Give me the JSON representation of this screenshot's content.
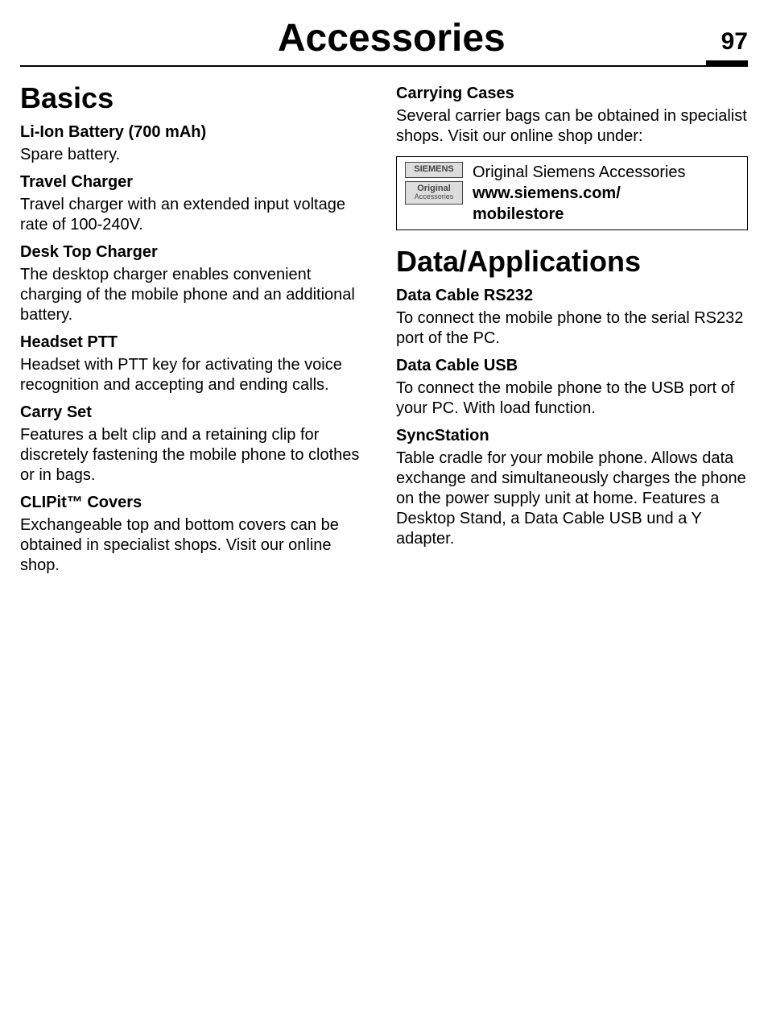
{
  "header": {
    "title": "Accessories",
    "page_number": "97"
  },
  "left": {
    "section_title": "Basics",
    "items": [
      {
        "heading": "Li-Ion Battery (700 mAh)",
        "body": "Spare battery."
      },
      {
        "heading": "Travel Charger",
        "body": "Travel charger with an extended input voltage rate of 100-240V."
      },
      {
        "heading": "Desk Top Charger",
        "body": "The desktop charger enables convenient charging of the mobile phone and an additional battery."
      },
      {
        "heading": "Headset PTT",
        "body": "Headset with PTT key for activating the voice recognition and accepting and ending calls."
      },
      {
        "heading": "Carry Set",
        "body": "Features a belt clip and a retaining clip for discretely fastening the mobile phone to clothes or in bags."
      },
      {
        "heading": "CLIPit™ Covers",
        "body": "Exchangeable top and bottom covers can be obtained in specialist shops. Visit our online shop."
      }
    ]
  },
  "right_top": {
    "heading": "Carrying Cases",
    "body": "Several carrier bags can be obtained in specialist shops. Visit our online shop under:",
    "promo": {
      "logo1_line1": "SIEMENS",
      "logo2_line1": "Original",
      "logo2_line2": "Accessories",
      "text_line1": "Original Siemens Accessories",
      "text_url": "www.siemens.com/\nmobilestore"
    }
  },
  "right_section2": {
    "title": "Data/Applications",
    "items": [
      {
        "heading": "Data Cable RS232",
        "body": "To connect the mobile phone to the serial RS232 port of the PC."
      },
      {
        "heading": "Data Cable USB",
        "body": "To connect the mobile phone to the USB port of your PC. With load function."
      },
      {
        "heading": "SyncStation",
        "body": "Table cradle for your mobile phone. Allows data exchange and simultaneously charges the phone on the power supply unit at home. Features a Desktop Stand, a Data Cable USB und a Y adapter."
      }
    ]
  }
}
